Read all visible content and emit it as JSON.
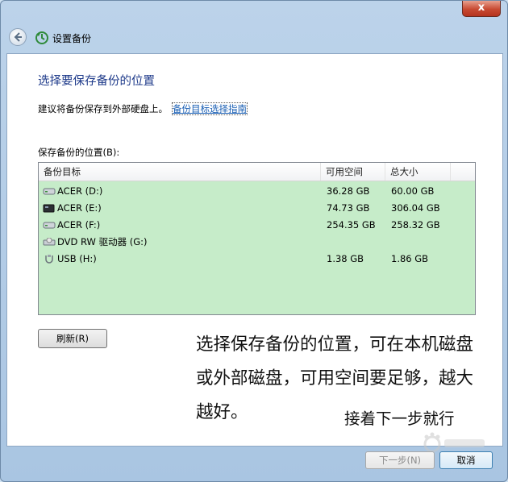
{
  "window": {
    "title": "设置备份",
    "close_glyph": "x"
  },
  "content": {
    "heading": "选择要保存备份的位置",
    "advice": "建议将备份保存到外部硬盘上。",
    "advice_link": "备份目标选择指南",
    "location_label": "保存备份的位置(B):"
  },
  "table": {
    "columns": [
      "备份目标",
      "可用空间",
      "总大小"
    ],
    "rows": [
      {
        "target": "ACER (D:)",
        "free": "36.28 GB",
        "total": "60.00 GB",
        "icon": "hard-drive-icon"
      },
      {
        "target": "ACER (E:)",
        "free": "74.73 GB",
        "total": "306.04 GB",
        "icon": "dark-drive-icon"
      },
      {
        "target": "ACER (F:)",
        "free": "254.35 GB",
        "total": "258.32 GB",
        "icon": "hard-drive-icon"
      },
      {
        "target": "DVD RW 驱动器 (G:)",
        "free": "",
        "total": "",
        "icon": "dvd-drive-icon"
      },
      {
        "target": "USB (H:)",
        "free": "1.38 GB",
        "total": "1.86 GB",
        "icon": "usb-drive-icon"
      }
    ]
  },
  "buttons": {
    "refresh": "刷新(R)",
    "next": "下一步(N)",
    "cancel": "取消"
  },
  "annotation": {
    "main": "选择保存备份的位置，可在本机磁盘或外部磁盘，可用空间要足够，越大越好。",
    "secondary": "接着下一步就行"
  },
  "colors": {
    "list_background": "#c6ecc9",
    "heading_color": "#1e3a8a",
    "link_color": "#1a5fb4"
  }
}
